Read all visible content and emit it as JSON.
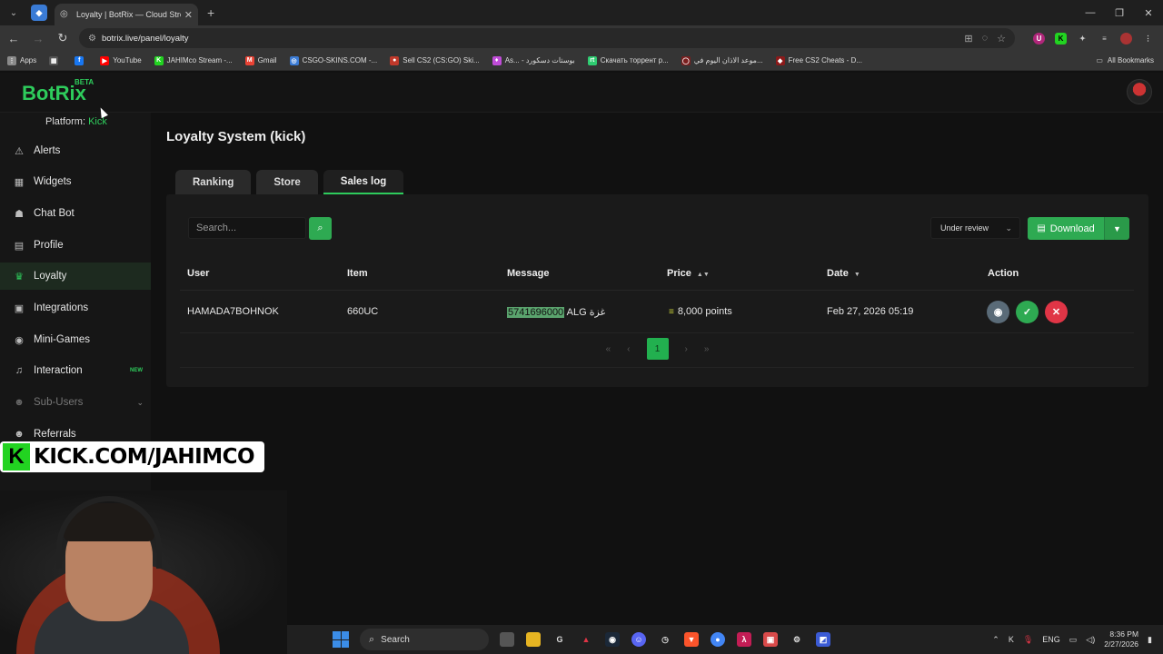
{
  "browser": {
    "tab_title": "Loyalty | BotRix — Cloud Stream",
    "url": "botrix.live/panel/loyalty",
    "bookmarks": [
      {
        "label": "Apps",
        "color": "#8a8a8a",
        "glyph": "⋮"
      },
      {
        "label": "",
        "color": "#555555",
        "glyph": "▦"
      },
      {
        "label": "",
        "color": "#1877f2",
        "glyph": "f"
      },
      {
        "label": "YouTube",
        "color": "#ff0000",
        "glyph": "▶"
      },
      {
        "label": "JAHIMco Stream -...",
        "color": "#22d321",
        "glyph": "K"
      },
      {
        "label": "Gmail",
        "color": "#ea4335",
        "glyph": "M"
      },
      {
        "label": "CSGO-SKINS.COM -...",
        "color": "#3a7bd5",
        "glyph": "◎"
      },
      {
        "label": "Sell CS2 (CS:GO) Ski...",
        "color": "#c0392b",
        "glyph": "●"
      },
      {
        "label": "As... - بوستات دسكورد",
        "color": "#c04cd8",
        "glyph": "♦"
      },
      {
        "label": "Скачать торрент р...",
        "color": "#2ecc71",
        "glyph": "rt"
      },
      {
        "label": "موعد الاذان اليوم في...",
        "color": "#7a1f1f",
        "glyph": "◯"
      },
      {
        "label": "Free CS2 Cheats - D...",
        "color": "#8b1a1a",
        "glyph": "◆"
      }
    ],
    "all_bookmarks": "All Bookmarks"
  },
  "app": {
    "logo": "BotRix",
    "logo_badge": "BETA",
    "platform_label": "Platform:",
    "platform_value": "Kick"
  },
  "sidebar": {
    "items": [
      {
        "label": "Alerts",
        "icon": "warning-icon",
        "glyph": "⚠"
      },
      {
        "label": "Widgets",
        "icon": "widgets-icon",
        "glyph": "▦"
      },
      {
        "label": "Chat Bot",
        "icon": "robot-icon",
        "glyph": "☗"
      },
      {
        "label": "Profile",
        "icon": "profile-card-icon",
        "glyph": "▤"
      },
      {
        "label": "Loyalty",
        "icon": "trophy-icon",
        "glyph": "♛"
      },
      {
        "label": "Integrations",
        "icon": "integrations-icon",
        "glyph": "▣"
      },
      {
        "label": "Mini-Games",
        "icon": "gamepad-icon",
        "glyph": "◉"
      },
      {
        "label": "Interaction",
        "icon": "music-icon",
        "glyph": "♫",
        "badge": "NEW"
      },
      {
        "label": "Sub-Users",
        "icon": "users-icon",
        "glyph": "☻"
      },
      {
        "label": "Referrals",
        "icon": "referrals-icon",
        "glyph": "☻"
      }
    ]
  },
  "page": {
    "title": "Loyalty System (kick)",
    "tabs": [
      "Ranking",
      "Store",
      "Sales log"
    ],
    "active_tab": "Sales log",
    "search_placeholder": "Search...",
    "filter_value": "Under review",
    "download_label": "Download"
  },
  "table": {
    "headers": {
      "user": "User",
      "item": "Item",
      "message": "Message",
      "price": "Price",
      "date": "Date",
      "action": "Action"
    },
    "rows": [
      {
        "user": "HAMADA7BOHNOK",
        "item": "660UC",
        "message_highlight": "5741696000",
        "message_rest": " ALG غزة",
        "price": "8,000 points",
        "date": "Feb 27, 2026 05:19"
      }
    ]
  },
  "pagination": {
    "current": "1",
    "first": "«",
    "prev": "‹",
    "next": "›",
    "last": "»"
  },
  "overlay": {
    "logo": "K",
    "text": "KICK.COM/JAHIMCO"
  },
  "taskbar": {
    "search": "Search",
    "lang": "ENG",
    "time": "8:36 PM",
    "date": "2/27/2026"
  },
  "colors": {
    "accent": "#2ecc5c",
    "danger": "#e03546",
    "view": "#5a6b78"
  }
}
